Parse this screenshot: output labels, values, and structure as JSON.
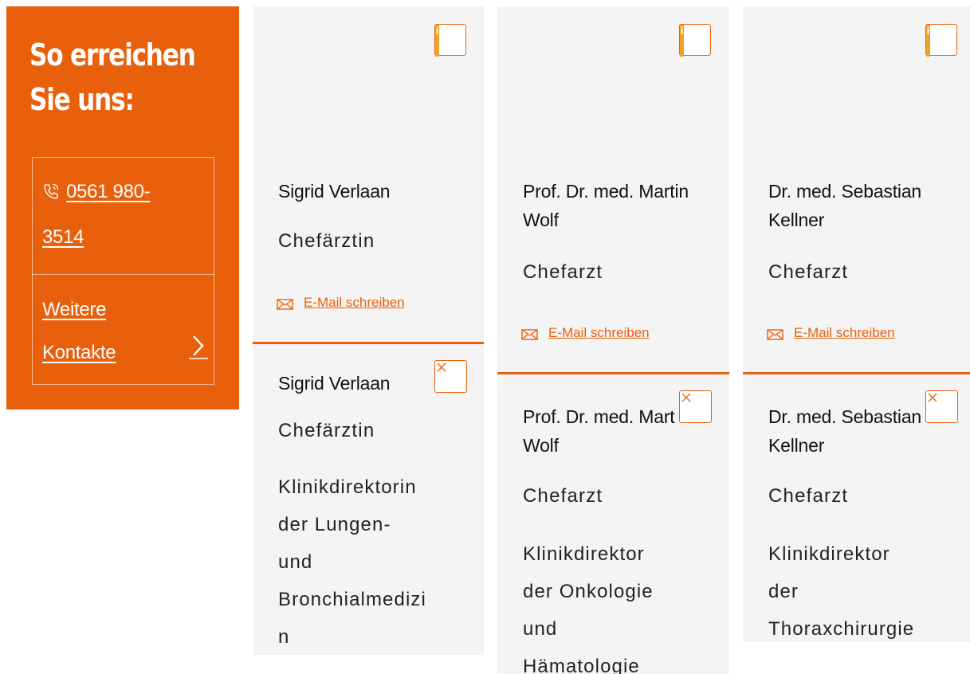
{
  "contact": {
    "title_line1": "So erreichen",
    "title_line2": "Sie uns:",
    "phone_line1": "0561 980-",
    "phone_line2": "3514",
    "more_line1": "Weitere",
    "more_line2": "Kontakte"
  },
  "icons": {
    "phone": "phone-icon",
    "chevron": "chevron-right-icon",
    "info": "info-icon",
    "close": "close-icon",
    "mail": "envelope-icon"
  },
  "colors": {
    "accent": "#e8600b",
    "info_mark": "#f1a128",
    "card_bg": "#f4f4f4"
  },
  "cards": [
    {
      "name_line1": "Sigrid Verlaan",
      "name_line2": "",
      "role": "Chefärztin",
      "mail_label": "E-Mail schreiben",
      "info_label": "i",
      "desc": [
        "Klinikdirektorin",
        "der Lungen-",
        "und",
        "Bronchialmedizi",
        "n"
      ]
    },
    {
      "name_line1": "Prof. Dr. med. Martin",
      "name_line2": "Wolf",
      "back_name_line1": "Prof. Dr. med. Mart",
      "role": "Chefarzt",
      "mail_label": "E-Mail schreiben",
      "info_label": "i",
      "desc": [
        "Klinikdirektor",
        "der Onkologie",
        "und",
        "Hämatologie"
      ]
    },
    {
      "name_line1": "Dr. med. Sebastian",
      "name_line2": "Kellner",
      "role": "Chefarzt",
      "mail_label": "E-Mail schreiben",
      "info_label": "i",
      "desc": [
        "Klinikdirektor",
        "der",
        "Thoraxchirurgie"
      ]
    }
  ]
}
